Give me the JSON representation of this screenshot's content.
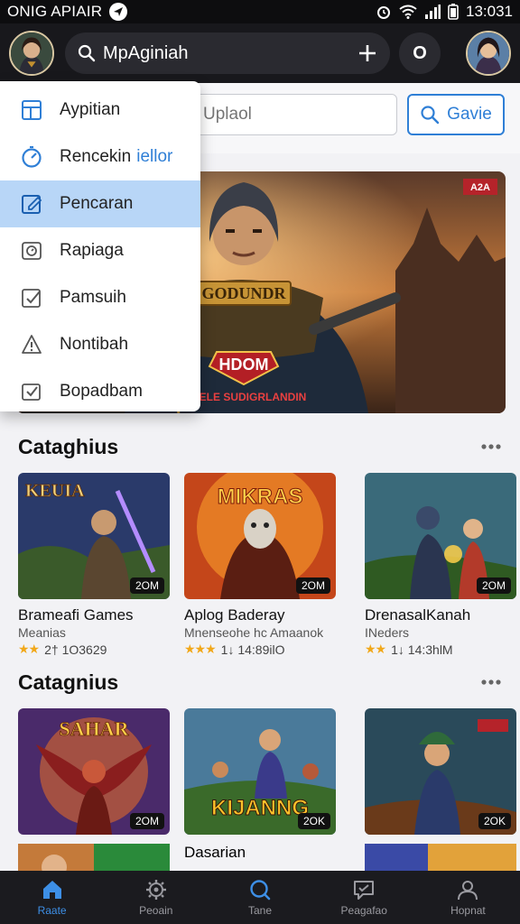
{
  "status_bar": {
    "left_text": "ONIG APIAIR",
    "time": "13:031"
  },
  "app_bar": {
    "search_value": "MpAginiah",
    "round_button_label": "O"
  },
  "search_area": {
    "upload_placeholder": "Uplaol",
    "game_button_label": "Gavie"
  },
  "dropdown": {
    "items": [
      {
        "label": "Aypitian",
        "accent": "",
        "icon": "layout-icon"
      },
      {
        "label": "Rencekin",
        "accent": "iellor",
        "icon": "speedometer-icon"
      },
      {
        "label": "Pencaran",
        "accent": "",
        "icon": "edit-icon",
        "active": true
      },
      {
        "label": "Rapiaga",
        "accent": "",
        "icon": "clock-icon"
      },
      {
        "label": "Pamsuih",
        "accent": "",
        "icon": "check-square-icon"
      },
      {
        "label": "Nontibah",
        "accent": "",
        "icon": "alert-icon"
      },
      {
        "label": "Bopadbam",
        "accent": "",
        "icon": "check-box-icon"
      }
    ]
  },
  "hero": {
    "title": "GODUNDR",
    "logo": "HDOM",
    "tagline": "PIAELE SUDIGRLANDIN",
    "corner_tag": "A2A"
  },
  "sections": [
    {
      "title": "Cataghius",
      "cards": [
        {
          "thumb_text": "KEUIA",
          "badge": "2OM",
          "title": "Brameafi Games",
          "subtitle": "Meanias",
          "stars": "★★",
          "rating_text": "2† 1O3629"
        },
        {
          "thumb_text": "MIKRAS",
          "badge": "2OM",
          "title": "Aplog Baderay",
          "subtitle": "Mnenseohe hc Amaanok",
          "stars": "★★★",
          "rating_text": "1↓ 14:89ilO"
        },
        {
          "thumb_text": "",
          "badge": "2OM",
          "title": "DrenasalKanah",
          "subtitle": "INeders",
          "stars": "★★",
          "rating_text": "1↓ 14:3hlM"
        }
      ]
    },
    {
      "title": "Catagnius",
      "cards": [
        {
          "thumb_text": "SAHAR",
          "badge": "2OM",
          "title": "",
          "subtitle": "",
          "stars": "",
          "rating_text": ""
        },
        {
          "thumb_text": "KIJANNG",
          "badge": "2OK",
          "title": "Dasarian",
          "subtitle": "",
          "stars": "",
          "rating_text": ""
        },
        {
          "thumb_text": "",
          "badge": "2OK",
          "title": "",
          "subtitle": "",
          "stars": "",
          "rating_text": ""
        }
      ]
    }
  ],
  "bottom_nav": [
    {
      "label": "Raate",
      "icon": "home-icon",
      "active": true
    },
    {
      "label": "Peoain",
      "icon": "gear-icon",
      "active": false
    },
    {
      "label": "Tane",
      "icon": "search-icon",
      "active": false
    },
    {
      "label": "Peagafao",
      "icon": "chat-icon",
      "active": false
    },
    {
      "label": "Hopnat",
      "icon": "profile-icon",
      "active": false
    }
  ],
  "colors": {
    "accent": "#2f7fd6",
    "menu_active": "#b8d6f7",
    "app_bar": "#18181c",
    "star": "#f1a81a"
  }
}
